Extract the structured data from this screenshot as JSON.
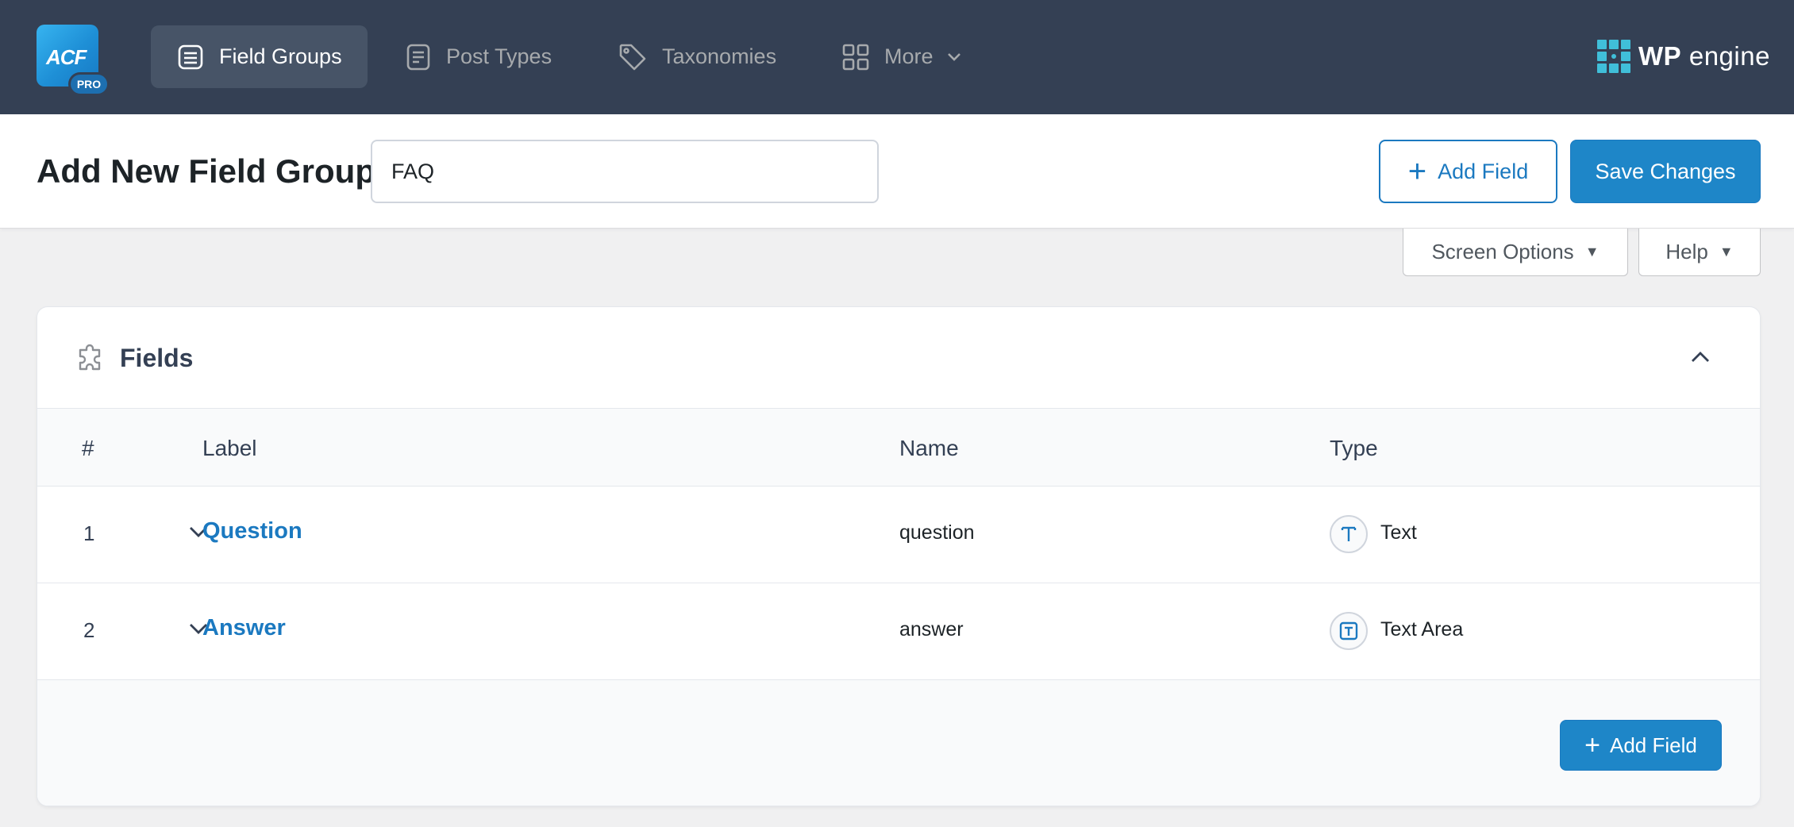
{
  "brand": {
    "logo_text": "ACF",
    "logo_badge": "PRO",
    "host_logo_bold": "WP",
    "host_logo_rest": "engine"
  },
  "nav": {
    "items": [
      {
        "label": "Field Groups",
        "icon": "field-groups-icon",
        "active": true
      },
      {
        "label": "Post Types",
        "icon": "post-types-icon",
        "active": false
      },
      {
        "label": "Taxonomies",
        "icon": "tag-icon",
        "active": false
      },
      {
        "label": "More",
        "icon": "grid-icon",
        "active": false
      }
    ]
  },
  "header": {
    "title": "Add New Field Group",
    "group_title_value": "FAQ",
    "add_field_label": "Add Field",
    "save_label": "Save Changes"
  },
  "screen_tabs": {
    "screen_options": "Screen Options",
    "help": "Help"
  },
  "fields_panel": {
    "title": "Fields",
    "columns": {
      "num": "#",
      "label": "Label",
      "name": "Name",
      "type": "Type"
    },
    "rows": [
      {
        "num": "1",
        "label": "Question",
        "name": "question",
        "type": "Text",
        "type_icon": "text-type-icon"
      },
      {
        "num": "2",
        "label": "Answer",
        "name": "answer",
        "type": "Text Area",
        "type_icon": "textarea-type-icon"
      }
    ],
    "add_field_label": "Add Field"
  },
  "colors": {
    "nav_bg": "#344054",
    "accent": "#1e86c8",
    "link": "#1b79c0"
  }
}
